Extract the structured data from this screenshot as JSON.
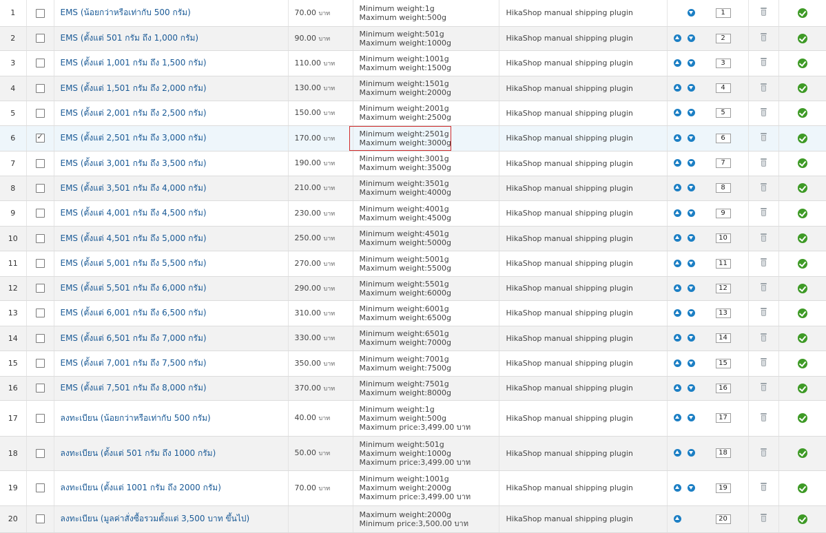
{
  "colors": {
    "link": "#1a5a96",
    "order_arrow": "#1c7fc4",
    "published": "#3e9a26",
    "highlight_border": "#d12b2b",
    "row_alt": "#f2f2f2",
    "row_selected": "#eef6fb"
  },
  "icons": {
    "move_up": "arrow-up-circle-icon",
    "move_down": "arrow-down-circle-icon",
    "delete": "trash-icon",
    "published": "check-circle-icon",
    "checkbox": "checkbox"
  },
  "rows": [
    {
      "num": "1",
      "name": "EMS (น้อยกว่าหรือเท่ากับ 500 กรัม)",
      "price": "70.00",
      "currency": "บาท",
      "restrictions": [
        "Minimum weight:1g",
        "Maximum weight:500g"
      ],
      "plugin": "HikaShop manual shipping plugin",
      "order": "1",
      "checked": false,
      "show_up": false,
      "show_down": true
    },
    {
      "num": "2",
      "name": "EMS (ตั้งแต่ 501 กรัม ถึง 1,000 กรัม)",
      "price": "90.00",
      "currency": "บาท",
      "restrictions": [
        "Minimum weight:501g",
        "Maximum weight:1000g"
      ],
      "plugin": "HikaShop manual shipping plugin",
      "order": "2",
      "checked": false,
      "show_up": true,
      "show_down": true
    },
    {
      "num": "3",
      "name": "EMS (ตั้งแต่ 1,001 กรัม ถึง 1,500 กรัม)",
      "price": "110.00",
      "currency": "บาท",
      "restrictions": [
        "Minimum weight:1001g",
        "Maximum weight:1500g"
      ],
      "plugin": "HikaShop manual shipping plugin",
      "order": "3",
      "checked": false,
      "show_up": true,
      "show_down": true
    },
    {
      "num": "4",
      "name": "EMS (ตั้งแต่ 1,501 กรัม ถึง 2,000 กรัม)",
      "price": "130.00",
      "currency": "บาท",
      "restrictions": [
        "Minimum weight:1501g",
        "Maximum weight:2000g"
      ],
      "plugin": "HikaShop manual shipping plugin",
      "order": "4",
      "checked": false,
      "show_up": true,
      "show_down": true
    },
    {
      "num": "5",
      "name": "EMS (ตั้งแต่ 2,001 กรัม ถึง 2,500 กรัม)",
      "price": "150.00",
      "currency": "บาท",
      "restrictions": [
        "Minimum weight:2001g",
        "Maximum weight:2500g"
      ],
      "plugin": "HikaShop manual shipping plugin",
      "order": "5",
      "checked": false,
      "show_up": true,
      "show_down": true
    },
    {
      "num": "6",
      "name": "EMS (ตั้งแต่ 2,501 กรัม ถึง 3,000 กรัม)",
      "price": "170.00",
      "currency": "บาท",
      "restrictions": [
        "Minimum weight:2501g",
        "Maximum weight:3000g"
      ],
      "plugin": "HikaShop manual shipping plugin",
      "order": "6",
      "checked": true,
      "show_up": true,
      "show_down": true
    },
    {
      "num": "7",
      "name": "EMS (ตั้งแต่ 3,001 กรัม ถึง 3,500 กรัม)",
      "price": "190.00",
      "currency": "บาท",
      "restrictions": [
        "Minimum weight:3001g",
        "Maximum weight:3500g"
      ],
      "plugin": "HikaShop manual shipping plugin",
      "order": "7",
      "checked": false,
      "show_up": true,
      "show_down": true
    },
    {
      "num": "8",
      "name": "EMS (ตั้งแต่ 3,501 กรัม ถึง 4,000 กรัม)",
      "price": "210.00",
      "currency": "บาท",
      "restrictions": [
        "Minimum weight:3501g",
        "Maximum weight:4000g"
      ],
      "plugin": "HikaShop manual shipping plugin",
      "order": "8",
      "checked": false,
      "show_up": true,
      "show_down": true
    },
    {
      "num": "9",
      "name": "EMS (ตั้งแต่ 4,001 กรัม ถึง 4,500 กรัม)",
      "price": "230.00",
      "currency": "บาท",
      "restrictions": [
        "Minimum weight:4001g",
        "Maximum weight:4500g"
      ],
      "plugin": "HikaShop manual shipping plugin",
      "order": "9",
      "checked": false,
      "show_up": true,
      "show_down": true
    },
    {
      "num": "10",
      "name": "EMS (ตั้งแต่ 4,501 กรัม ถึง 5,000 กรัม)",
      "price": "250.00",
      "currency": "บาท",
      "restrictions": [
        "Minimum weight:4501g",
        "Maximum weight:5000g"
      ],
      "plugin": "HikaShop manual shipping plugin",
      "order": "10",
      "checked": false,
      "show_up": true,
      "show_down": true
    },
    {
      "num": "11",
      "name": "EMS (ตั้งแต่ 5,001 กรัม ถึง 5,500 กรัม)",
      "price": "270.00",
      "currency": "บาท",
      "restrictions": [
        "Minimum weight:5001g",
        "Maximum weight:5500g"
      ],
      "plugin": "HikaShop manual shipping plugin",
      "order": "11",
      "checked": false,
      "show_up": true,
      "show_down": true
    },
    {
      "num": "12",
      "name": "EMS (ตั้งแต่ 5,501 กรัม ถึง 6,000 กรัม)",
      "price": "290.00",
      "currency": "บาท",
      "restrictions": [
        "Minimum weight:5501g",
        "Maximum weight:6000g"
      ],
      "plugin": "HikaShop manual shipping plugin",
      "order": "12",
      "checked": false,
      "show_up": true,
      "show_down": true
    },
    {
      "num": "13",
      "name": "EMS (ตั้งแต่ 6,001 กรัม ถึง 6,500 กรัม)",
      "price": "310.00",
      "currency": "บาท",
      "restrictions": [
        "Minimum weight:6001g",
        "Maximum weight:6500g"
      ],
      "plugin": "HikaShop manual shipping plugin",
      "order": "13",
      "checked": false,
      "show_up": true,
      "show_down": true
    },
    {
      "num": "14",
      "name": "EMS (ตั้งแต่ 6,501 กรัม ถึง 7,000 กรัม)",
      "price": "330.00",
      "currency": "บาท",
      "restrictions": [
        "Minimum weight:6501g",
        "Maximum weight:7000g"
      ],
      "plugin": "HikaShop manual shipping plugin",
      "order": "14",
      "checked": false,
      "show_up": true,
      "show_down": true
    },
    {
      "num": "15",
      "name": "EMS (ตั้งแต่ 7,001 กรัม ถึง 7,500 กรัม)",
      "price": "350.00",
      "currency": "บาท",
      "restrictions": [
        "Minimum weight:7001g",
        "Maximum weight:7500g"
      ],
      "plugin": "HikaShop manual shipping plugin",
      "order": "15",
      "checked": false,
      "show_up": true,
      "show_down": true
    },
    {
      "num": "16",
      "name": "EMS (ตั้งแต่ 7,501 กรัม ถึง 8,000 กรัม)",
      "price": "370.00",
      "currency": "บาท",
      "restrictions": [
        "Minimum weight:7501g",
        "Maximum weight:8000g"
      ],
      "plugin": "HikaShop manual shipping plugin",
      "order": "16",
      "checked": false,
      "show_up": true,
      "show_down": true
    },
    {
      "num": "17",
      "name": "ลงทะเบียน (น้อยกว่าหรือเท่ากับ 500 กรัม)",
      "price": "40.00",
      "currency": "บาท",
      "restrictions": [
        "Minimum weight:1g",
        "Maximum weight:500g",
        "Maximum price:3,499.00 บาท"
      ],
      "plugin": "HikaShop manual shipping plugin",
      "order": "17",
      "checked": false,
      "show_up": true,
      "show_down": true
    },
    {
      "num": "18",
      "name": "ลงทะเบียน (ตั้งแต่ 501 กรัม ถึง 1000 กรัม)",
      "price": "50.00",
      "currency": "บาท",
      "restrictions": [
        "Minimum weight:501g",
        "Maximum weight:1000g",
        "Maximum price:3,499.00 บาท"
      ],
      "plugin": "HikaShop manual shipping plugin",
      "order": "18",
      "checked": false,
      "show_up": true,
      "show_down": true
    },
    {
      "num": "19",
      "name": "ลงทะเบียน (ตั้งแต่ 1001 กรัม ถึง 2000 กรัม)",
      "price": "70.00",
      "currency": "บาท",
      "restrictions": [
        "Minimum weight:1001g",
        "Maximum weight:2000g",
        "Maximum price:3,499.00 บาท"
      ],
      "plugin": "HikaShop manual shipping plugin",
      "order": "19",
      "checked": false,
      "show_up": true,
      "show_down": true
    },
    {
      "num": "20",
      "name": "ลงทะเบียน (มูลค่าสั่งซื้อรวมตั้งแต่ 3,500 บาท ขึ้นไป)",
      "price": "",
      "currency": "",
      "restrictions": [
        "Maximum weight:2000g",
        "Minimum price:3,500.00 บาท"
      ],
      "plugin": "HikaShop manual shipping plugin",
      "order": "20",
      "checked": false,
      "show_up": true,
      "show_down": false
    }
  ]
}
